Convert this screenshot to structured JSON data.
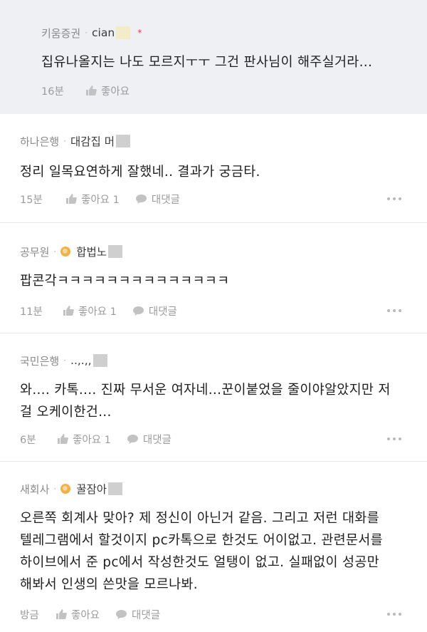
{
  "comments": [
    {
      "company": "키움증권",
      "nickname": "cian",
      "text": "집유나올지는 나도 모르지ㅜㅜ 그건 판사님이 해주실거라...",
      "time": "16분",
      "like_label": "좋아요",
      "reply_label": ""
    },
    {
      "company": "하나은행",
      "nickname": "대감집 머",
      "text": "정리 일목요연하게 잘했네.. 결과가 궁금타.",
      "time": "15분",
      "like_label": "좋아요 1",
      "reply_label": "대댓글"
    },
    {
      "company": "공무원",
      "nickname": "합법노",
      "text": "팝콘각ㅋㅋㅋㅋㅋㅋㅋㅋㅋㅋㅋㅋㅋㅋ",
      "time": "11분",
      "like_label": "좋아요 1",
      "reply_label": "대댓글"
    },
    {
      "company": "국민은행",
      "nickname": "..,.,,",
      "text_lines": [
        "와.... 카톡.... 진짜 무서운 여자네...꾼이붙었을 줄이야알았지만 저",
        "걸 오케이한건..."
      ],
      "time": "6분",
      "like_label": "좋아요 1",
      "reply_label": "대댓글"
    },
    {
      "company": "새회사",
      "nickname": "꿀잠아",
      "text_lines": [
        "오른쪽 회계사 맞아? 제 정신이 아닌거 같음. 그리고 저런 대화를",
        "텔레그램에서 할것이지 pc카톡으로 한것도 어이없고. 관련문서를",
        "하이브에서 준 pc에서 작성한것도 얼탱이 없고. 실패없이 성공만",
        "해봐서 인생의 쓴맛을 모르나봐."
      ],
      "time": "방금",
      "like_label": "좋아요",
      "reply_label": "대댓글"
    }
  ],
  "colors": {
    "op_marker": "#e2354e",
    "badge": "#f0b145"
  }
}
